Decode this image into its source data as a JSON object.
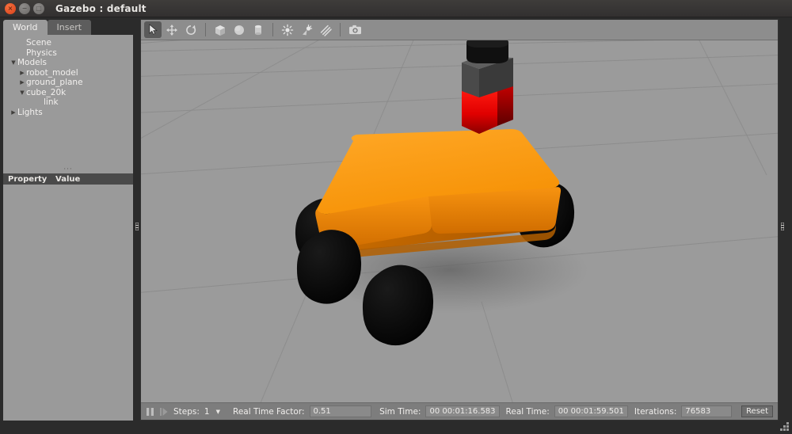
{
  "window": {
    "title": "Gazebo : default",
    "buttons": [
      {
        "name": "close",
        "glyph": "×"
      },
      {
        "name": "minimize",
        "glyph": "−"
      },
      {
        "name": "maximize",
        "glyph": "□"
      }
    ]
  },
  "left_panel": {
    "tabs": [
      {
        "label": "World",
        "active": true
      },
      {
        "label": "Insert",
        "active": false
      }
    ],
    "tree": [
      {
        "label": "Scene",
        "indent": 1,
        "arrow": ""
      },
      {
        "label": "Physics",
        "indent": 1,
        "arrow": ""
      },
      {
        "label": "Models",
        "indent": 0,
        "arrow": "▼"
      },
      {
        "label": "robot_model",
        "indent": 1,
        "arrow": "▶"
      },
      {
        "label": "ground_plane",
        "indent": 1,
        "arrow": "▶"
      },
      {
        "label": "cube_20k",
        "indent": 1,
        "arrow": "▼"
      },
      {
        "label": "link",
        "indent": 3,
        "arrow": ""
      },
      {
        "label": "Lights",
        "indent": 0,
        "arrow": "▶"
      }
    ],
    "property_header": {
      "property": "Property",
      "value": "Value"
    },
    "splitter_dots": "···"
  },
  "toolbar": {
    "items": [
      {
        "name": "select-arrow-tool",
        "icon": "arrow",
        "active": true
      },
      {
        "name": "translate-tool",
        "icon": "move",
        "active": false
      },
      {
        "name": "rotate-tool",
        "icon": "rotate",
        "active": false
      },
      {
        "name": "separator-1",
        "icon": "sep",
        "active": false
      },
      {
        "name": "insert-box-tool",
        "icon": "box",
        "active": false
      },
      {
        "name": "insert-sphere-tool",
        "icon": "sphere",
        "active": false
      },
      {
        "name": "insert-cylinder-tool",
        "icon": "cylinder",
        "active": false
      },
      {
        "name": "separator-2",
        "icon": "sep",
        "active": false
      },
      {
        "name": "insert-point-light-tool",
        "icon": "pointlight",
        "active": false
      },
      {
        "name": "insert-spot-light-tool",
        "icon": "spotlight",
        "active": false
      },
      {
        "name": "insert-directional-light-tool",
        "icon": "dirlight",
        "active": false
      },
      {
        "name": "separator-3",
        "icon": "sep",
        "active": false
      },
      {
        "name": "screenshot-tool",
        "icon": "camera",
        "active": false
      }
    ]
  },
  "viewport": {
    "scene_objects": [
      {
        "name": "ground_plane",
        "color": "#9b9b9b"
      },
      {
        "name": "robot-chassis",
        "color": "#f59000"
      },
      {
        "name": "robot-wheel",
        "color": "#0a0a0a"
      },
      {
        "name": "sensor-red-block",
        "color": "#e00000"
      },
      {
        "name": "sensor-gray-block",
        "color": "#4e4e4e"
      },
      {
        "name": "sensor-black-cap",
        "color": "#101010"
      }
    ]
  },
  "statusbar": {
    "pause_icon": "pause-icon",
    "step_icon": "step-forward-icon",
    "steps_label": "Steps:",
    "steps_value": "1",
    "rtf_label": "Real Time Factor:",
    "rtf_value": "0.51",
    "sim_time_label": "Sim Time:",
    "sim_time_value": "00 00:01:16.583",
    "real_time_label": "Real Time:",
    "real_time_value": "00 00:01:59.501",
    "iterations_label": "Iterations:",
    "iterations_value": "76583",
    "reset_label": "Reset"
  },
  "colors": {
    "chassis_orange": "#f59000",
    "sensor_red": "#e00000",
    "panel_gray": "#9a9a9a",
    "viewport_gray": "#9b9b9b",
    "titlebar": "#3a3836"
  }
}
